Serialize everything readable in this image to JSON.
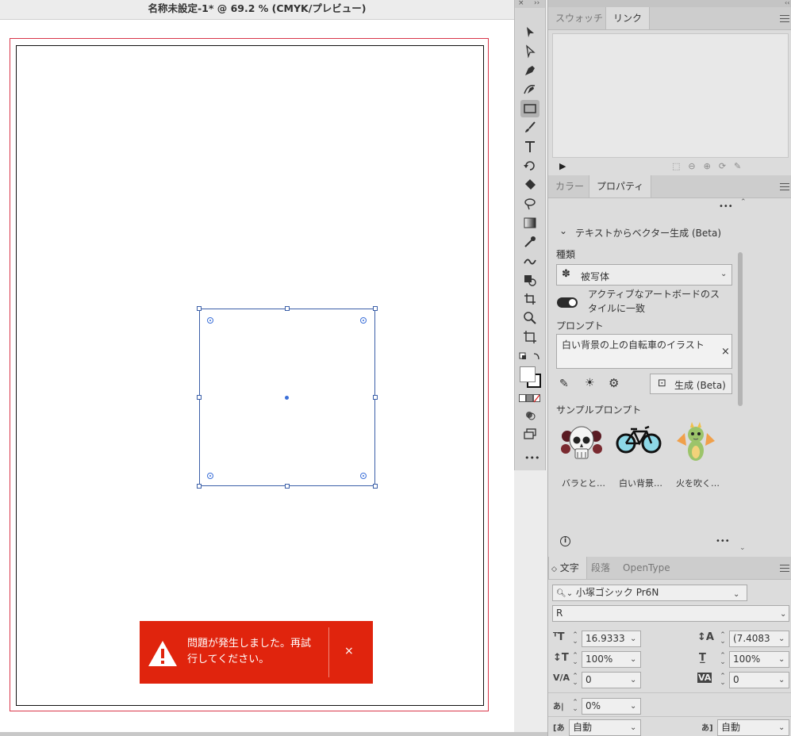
{
  "document": {
    "title": "名称未設定-1* @ 69.2 % (CMYK/プレビュー)"
  },
  "toast": {
    "message": "問題が発生しました。再試行してください。",
    "close": "×"
  },
  "toolbar": {
    "top_left": "×",
    "top_right": "››",
    "tools": [
      "selection-tool",
      "direct-selection-tool",
      "pen-tool",
      "curvature-tool",
      "rectangle-tool",
      "paintbrush-tool",
      "type-tool",
      "rotate-tool",
      "eraser-tool",
      "lasso-tool",
      "gradient-tool",
      "eyedropper-tool",
      "blend-tool",
      "shape-builder-tool",
      "crop-tool",
      "zoom-tool",
      "artboard-tool"
    ],
    "more": "•••"
  },
  "links_panel": {
    "tabs": [
      "スウォッチ",
      "リンク"
    ],
    "active_tab": "リンク"
  },
  "properties_panel": {
    "tabs": [
      "カラー",
      "プロパティ"
    ],
    "active_tab": "プロパティ",
    "more": "•••",
    "section_title": "テキストからベクター生成 (Beta)",
    "type_label": "種類",
    "type_value": "被写体",
    "toggle_label": "アクティブなアートボードのスタイルに一致",
    "toggle_on": true,
    "prompt_label": "プロンプト",
    "prompt_value": "白い背景の上の自転車のイラスト",
    "prompt_clear": "×",
    "generate_button": "生成 (Beta)",
    "samples_label": "サンプルプロンプト",
    "samples": [
      {
        "label": "バラとと…",
        "icon": "skull-roses-icon"
      },
      {
        "label": "白い背景…",
        "icon": "bicycle-icon"
      },
      {
        "label": "火を吹く…",
        "icon": "dragon-icon"
      }
    ],
    "footer_more": "•••"
  },
  "character_panel": {
    "tabs": [
      "文字",
      "段落",
      "OpenType"
    ],
    "active_tab": "文字",
    "font_family": "小塚ゴシック Pr6N",
    "font_style": "R",
    "font_size": "16.9333",
    "leading": "(7.4083",
    "vertical_scale": "100%",
    "horizontal_scale": "100%",
    "kerning": "0",
    "tracking": "0",
    "tsume": "0%",
    "aki_left": "自動",
    "aki_right": "自動"
  },
  "colors": {
    "toast_bg": "#e0240d",
    "bleed": "#d9364a",
    "selection": "#3b5fa8"
  }
}
